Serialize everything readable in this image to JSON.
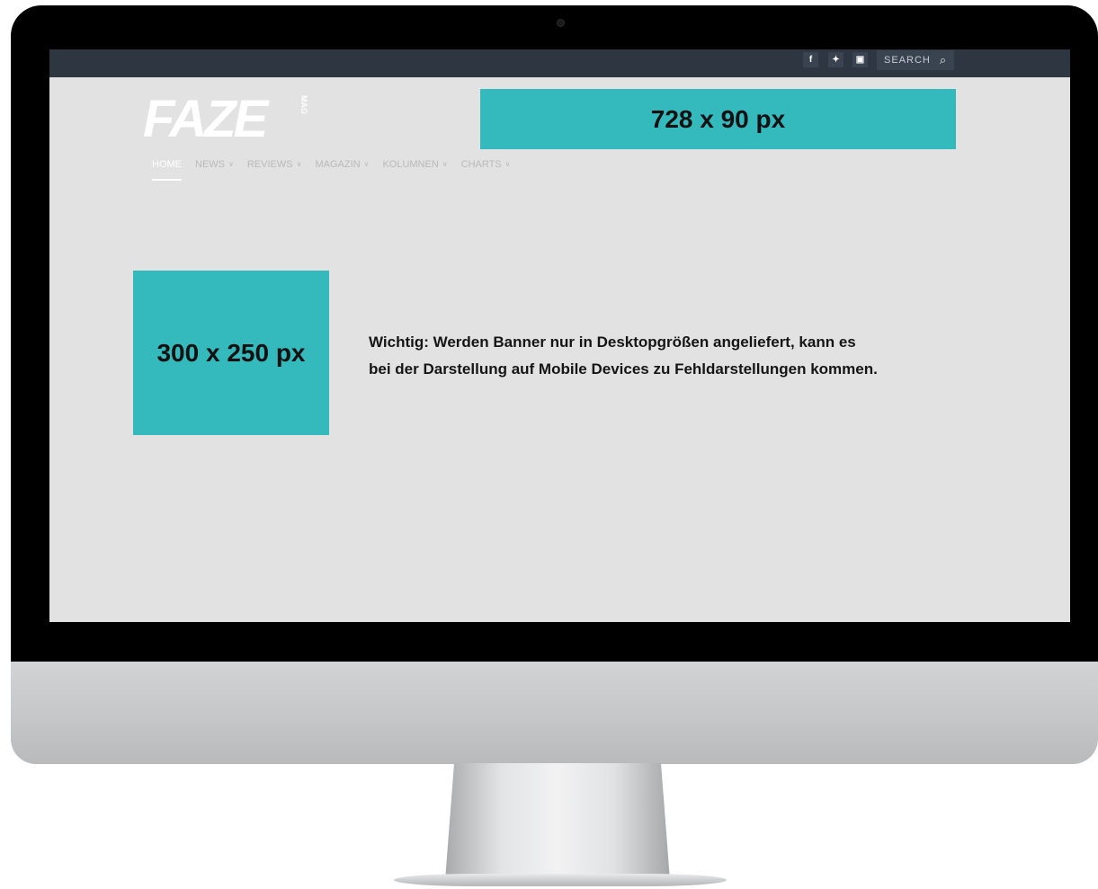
{
  "topbar": {
    "social": [
      {
        "name": "facebook-icon",
        "glyph": "f"
      },
      {
        "name": "twitter-icon",
        "glyph": "✦"
      },
      {
        "name": "instagram-icon",
        "glyph": "▣"
      }
    ],
    "search_label": "SEARCH",
    "search_icon": "⌕"
  },
  "logo": {
    "text": "FAZE",
    "sub": "MAG"
  },
  "ads": {
    "leaderboard": "728 x 90 px",
    "medium_rectangle": "300 x 250 px"
  },
  "nav": {
    "items": [
      {
        "label": "HOME",
        "dropdown": ""
      },
      {
        "label": "NEWS",
        "dropdown": "∨"
      },
      {
        "label": "REVIEWS",
        "dropdown": "∨"
      },
      {
        "label": "MAGAZIN",
        "dropdown": "∨"
      },
      {
        "label": "KOLUMNEN",
        "dropdown": "∨"
      },
      {
        "label": "CHARTS",
        "dropdown": "∨"
      }
    ]
  },
  "notice": {
    "line1": "Wichtig: Werden Banner nur in Desktopgrößen angeliefert, kann es",
    "line2": "bei der Darstellung auf Mobile Devices zu Fehldarstellungen kommen."
  },
  "colors": {
    "ad_fill": "#34b9bd",
    "topbar": "#2e3741",
    "screen_bg": "#e2e2e2"
  }
}
